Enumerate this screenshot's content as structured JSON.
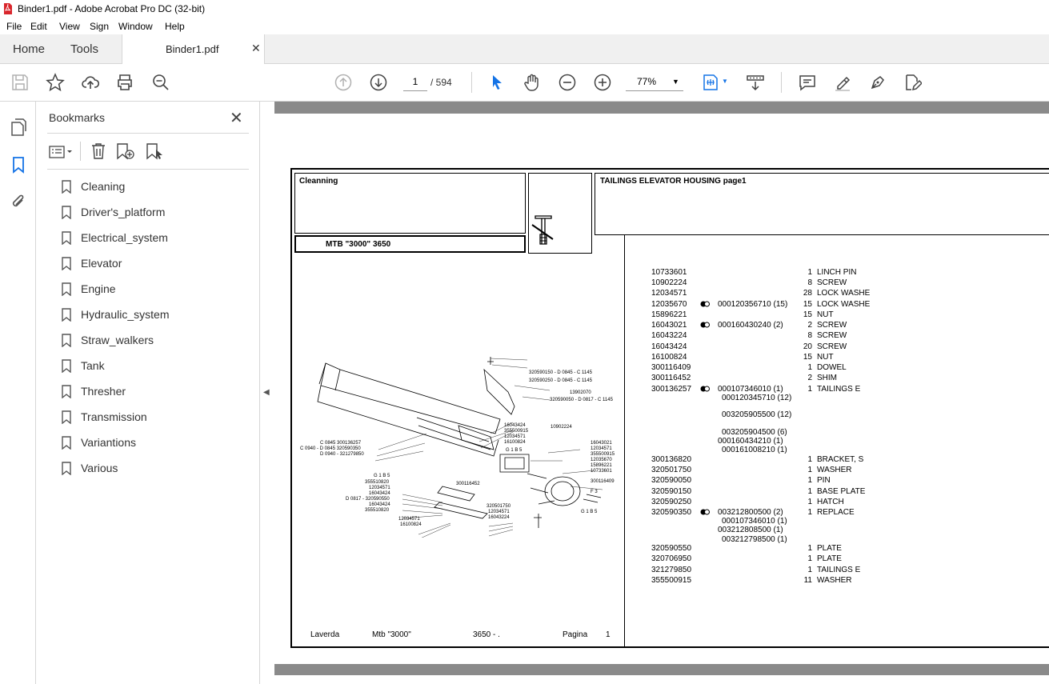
{
  "window": {
    "title": "Binder1.pdf - Adobe Acrobat Pro DC (32-bit)"
  },
  "menu": [
    "File",
    "Edit",
    "View",
    "Sign",
    "Window",
    "Help"
  ],
  "tabs": {
    "home": "Home",
    "tools": "Tools",
    "document": "Binder1.pdf"
  },
  "toolbar": {
    "current_page": "1",
    "total_pages": "/ 594",
    "zoom": "77%"
  },
  "bookmarks": {
    "title": "Bookmarks",
    "items": [
      "Cleaning",
      "Driver's_platform",
      "Electrical_system",
      "Elevator",
      "Engine",
      "Hydraulic_system",
      "Straw_walkers",
      "Tank",
      "Thresher",
      "Transmission",
      "Variantions",
      "Various"
    ]
  },
  "doc": {
    "group": "Cleanning",
    "model": "MTB \"3000\" 3650",
    "heading": "TAILINGS ELEVATOR HOUSING  page1",
    "footer": {
      "brand": "Laverda",
      "model": "Mtb \"3000\"",
      "code": "3650 - .",
      "page_label": "Pagina",
      "page_no": "1"
    },
    "parts": [
      {
        "code": "10733601",
        "qty": "1",
        "desc": "LINCH PIN"
      },
      {
        "code": "10902224",
        "qty": "8",
        "desc": "SCREW"
      },
      {
        "code": "12034571",
        "qty": "28",
        "desc": "LOCK WASHE"
      },
      {
        "code": "12035670",
        "alt": "000120356710  (15)",
        "qty": "15",
        "desc": "LOCK WASHE"
      },
      {
        "code": "15896221",
        "qty": "15",
        "desc": "NUT"
      },
      {
        "code": "16043021",
        "alt": "000160430240  (2)",
        "qty": "2",
        "desc": "SCREW"
      },
      {
        "code": "16043224",
        "qty": "8",
        "desc": "SCREW"
      },
      {
        "code": "16043424",
        "qty": "20",
        "desc": "SCREW"
      },
      {
        "code": "16100824",
        "qty": "15",
        "desc": "NUT"
      },
      {
        "code": "300116409",
        "qty": "1",
        "desc": "DOWEL"
      },
      {
        "code": "300116452",
        "qty": "2",
        "desc": "SHIM"
      },
      {
        "code": "300136257",
        "alt": "000107346010  (1)",
        "qty": "1",
        "desc": "TAILINGS E"
      },
      {
        "code": "300136820",
        "qty": "1",
        "desc": "BRACKET, S"
      },
      {
        "code": "320501750",
        "qty": "1",
        "desc": "WASHER"
      },
      {
        "code": "320590050",
        "qty": "1",
        "desc": "PIN"
      },
      {
        "code": "320590150",
        "qty": "1",
        "desc": "BASE PLATE"
      },
      {
        "code": "320590250",
        "qty": "1",
        "desc": "HATCH"
      },
      {
        "code": "320590350",
        "alt": "003212800500  (2)",
        "qty": "1",
        "desc": "REPLACE"
      },
      {
        "code": "320590550",
        "qty": "1",
        "desc": "PLATE"
      },
      {
        "code": "320706950",
        "qty": "1",
        "desc": "PLATE"
      },
      {
        "code": "321279850",
        "qty": "1",
        "desc": "TAILINGS E"
      },
      {
        "code": "355500915",
        "qty": "11",
        "desc": "WASHER"
      }
    ],
    "subs": [
      "000120345710  (12)",
      "003205905500  (12)",
      "003205904500  (6)",
      "000160434210  (1)",
      "000161008210  (1)",
      "000107346010  (1)",
      "003212808500  (1)",
      "003212798500  (1)"
    ],
    "diagram_labels": [
      "320590150 - D 0845 - C 1145",
      "320590250 - D 0845 - C 1145",
      "13902070",
      "320590050 - D 0817 - C 1145",
      "10902224",
      "16043424",
      "355500915",
      "12034571",
      "16100824",
      "C 0845  300136257",
      "C 0940 - D 0845  320590350",
      "D 0940 - 321279850",
      "G 1 B 5",
      "16043021",
      "12034571",
      "355500915",
      "12035670",
      "15896221",
      "10733601",
      "300116409",
      "300116452",
      "G 1 B 5",
      "355510820",
      "12034571",
      "16043424",
      "D 0817 - 320590550",
      "16043424",
      "355510820",
      "12034571",
      "16100824",
      "320501750",
      "12034571",
      "16043224",
      "F 3",
      "G 1 B 5"
    ]
  }
}
